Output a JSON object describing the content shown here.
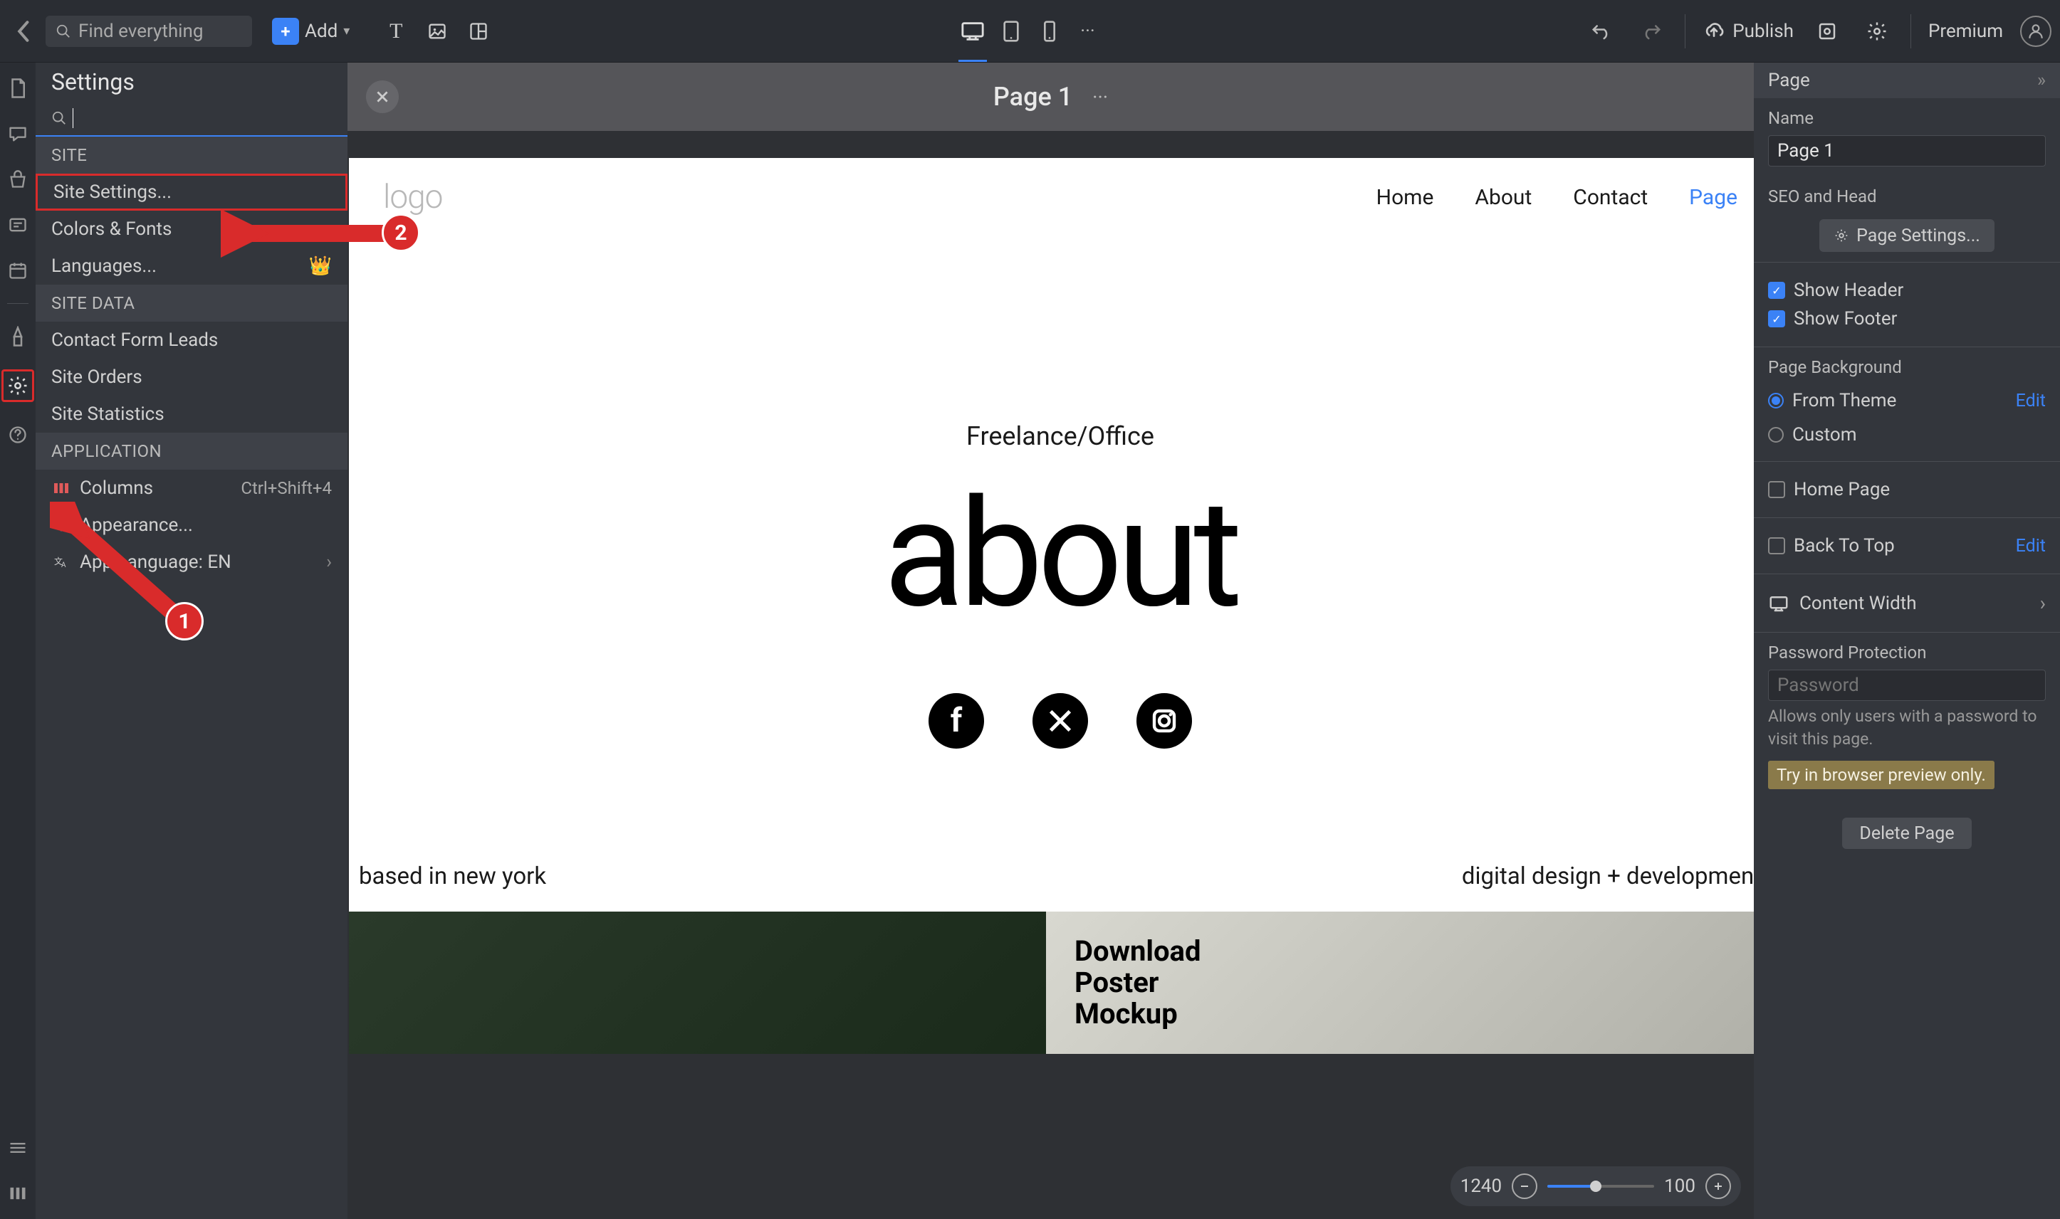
{
  "topbar": {
    "search_placeholder": "Find everything",
    "add_label": "Add",
    "publish_label": "Publish",
    "premium_label": "Premium"
  },
  "settings_panel": {
    "title": "Settings",
    "sections": {
      "site": {
        "header": "SITE",
        "items": [
          "Site Settings...",
          "Colors & Fonts",
          "Languages..."
        ]
      },
      "site_data": {
        "header": "SITE DATA",
        "items": [
          "Contact Form Leads",
          "Site Orders",
          "Site Statistics"
        ]
      },
      "application": {
        "header": "APPLICATION",
        "columns_label": "Columns",
        "columns_shortcut": "Ctrl+Shift+4",
        "appearance_label": "Appearance...",
        "app_lang_label": "App Language: EN"
      }
    }
  },
  "page_bar": {
    "title": "Page 1"
  },
  "canvas": {
    "logo": "logo",
    "nav": [
      "Home",
      "About",
      "Contact",
      "Page"
    ],
    "subtitle": "Freelance/Office",
    "headline": "about",
    "left_caption": "based in new york",
    "right_caption": "digital design + development",
    "poster_caption": "Download\nPoster\nMockup"
  },
  "zoom": {
    "current": "1240",
    "base": "100"
  },
  "right_panel": {
    "header": "Page",
    "name_label": "Name",
    "name_value": "Page 1",
    "seo_label": "SEO and Head",
    "page_settings_btn": "Page Settings...",
    "show_header": "Show Header",
    "show_footer": "Show Footer",
    "bg_label": "Page Background",
    "from_theme": "From Theme",
    "custom": "Custom",
    "edit": "Edit",
    "home_page": "Home Page",
    "back_to_top": "Back To Top",
    "content_width": "Content Width",
    "pw_label": "Password Protection",
    "pw_placeholder": "Password",
    "pw_hint": "Allows only users with a password to visit this page.",
    "preview_warn": "Try in browser preview only.",
    "delete_btn": "Delete Page"
  },
  "callouts": {
    "one": "1",
    "two": "2"
  }
}
